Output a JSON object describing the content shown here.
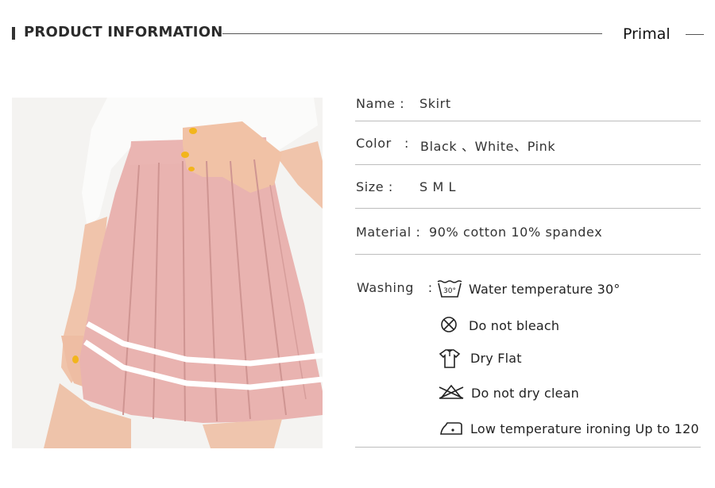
{
  "header": {
    "title": "PRODUCT INFORMATION",
    "brand": "Primal"
  },
  "product_image": {
    "alt": "pink pleated skirt"
  },
  "info": {
    "name_label": "Name :",
    "name_value": "Skirt",
    "color_label": "Color",
    "color_colon": ":",
    "color_value": "Black 、White、Pink",
    "size_label": "Size :",
    "size_value": "S M L",
    "material_label": "Material :",
    "material_value": "90% cotton 10% spandex"
  },
  "washing": {
    "label": "Washing",
    "colon": ":",
    "items": [
      {
        "icon": "wash-30-icon",
        "text": "Water temperature 30°",
        "tub_text": "30°"
      },
      {
        "icon": "no-bleach-icon",
        "text": "Do not bleach"
      },
      {
        "icon": "dry-flat-icon",
        "text": "Dry Flat"
      },
      {
        "icon": "no-dry-clean-icon",
        "text": "Do not dry clean"
      },
      {
        "icon": "low-iron-icon",
        "text": "Low temperature ironing Up to 120"
      }
    ]
  },
  "colors": {
    "skirt_pink": "#e8b0ad",
    "stripe": "#ffffff",
    "shirt": "#f7f7f5",
    "skin": "#f0c3aa",
    "nail": "#f2b51c"
  }
}
